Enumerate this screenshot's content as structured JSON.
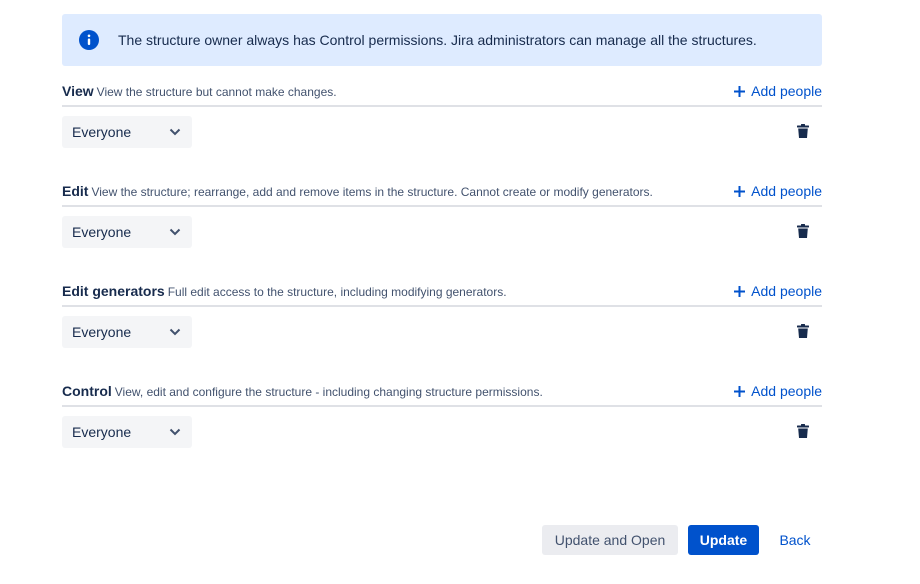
{
  "info_banner": {
    "icon": "info-icon",
    "text": "The structure owner always has Control permissions. Jira administrators can manage all the structures."
  },
  "permissions": [
    {
      "title": "View",
      "description": "View the structure but cannot make changes.",
      "add_label": "Add people",
      "select_value": "Everyone"
    },
    {
      "title": "Edit",
      "description": "View the structure; rearrange, add and remove items in the structure. Cannot create or modify generators.",
      "add_label": "Add people",
      "select_value": "Everyone"
    },
    {
      "title": "Edit generators",
      "description": "Full edit access to the structure, including modifying generators.",
      "add_label": "Add people",
      "select_value": "Everyone"
    },
    {
      "title": "Control",
      "description": "View, edit and configure the structure - including changing structure permissions.",
      "add_label": "Add people",
      "select_value": "Everyone"
    }
  ],
  "actions": {
    "update_and_open": "Update and Open",
    "update": "Update",
    "back": "Back"
  },
  "colors": {
    "accent": "#0052cc",
    "banner_bg": "#deebff",
    "text": "#172b4d",
    "subtle_text": "#42526e",
    "select_bg": "#f4f5f7",
    "divider": "#dfe1e6"
  }
}
